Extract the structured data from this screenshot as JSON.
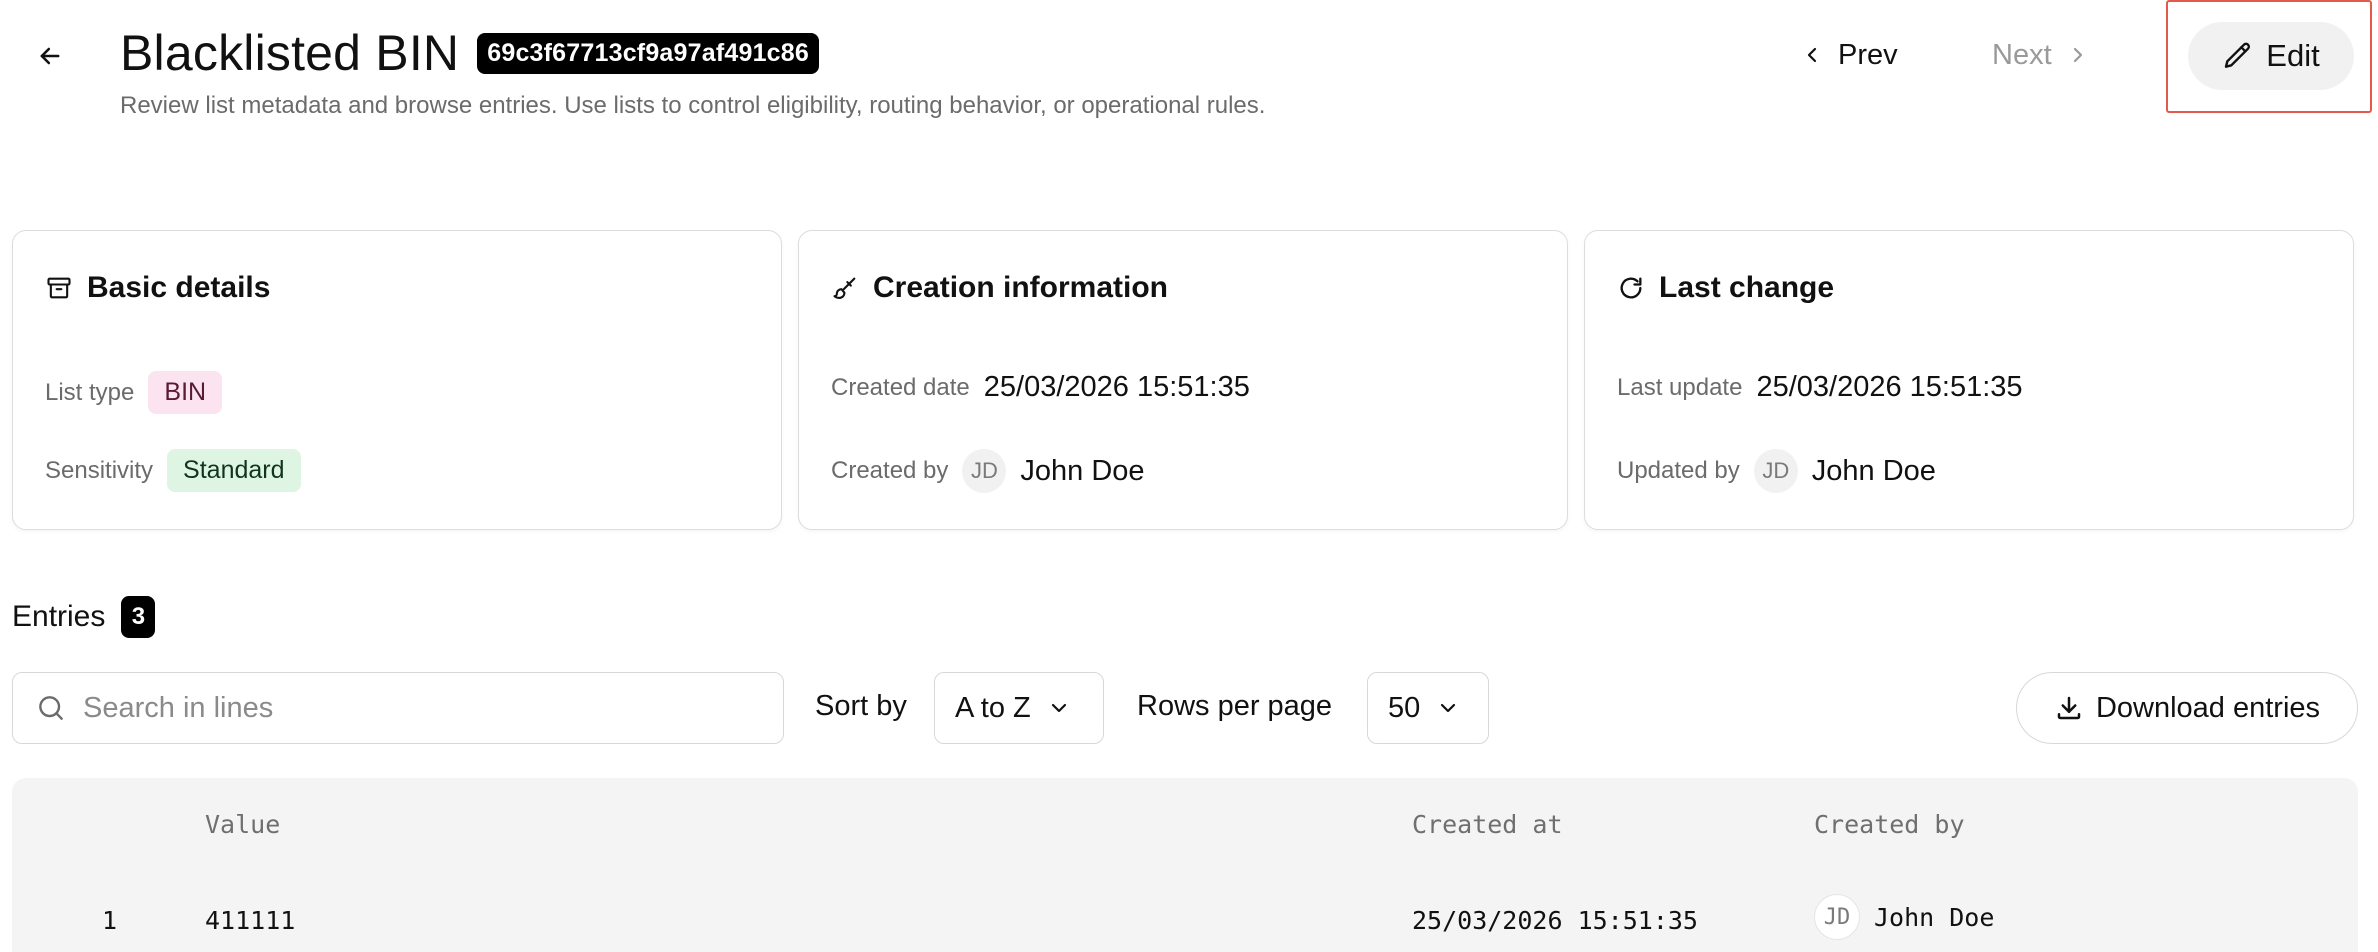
{
  "header": {
    "title": "Blacklisted BIN",
    "id_badge": "69c3f67713cf9a97af491c86",
    "subtitle": "Review list metadata and browse entries. Use lists to control eligibility, routing behavior, or operational rules.",
    "prev_label": "Prev",
    "next_label": "Next",
    "edit_label": "Edit"
  },
  "cards": {
    "basic": {
      "title": "Basic details",
      "list_type_label": "List type",
      "list_type_value": "BIN",
      "sensitivity_label": "Sensitivity",
      "sensitivity_value": "Standard"
    },
    "creation": {
      "title": "Creation information",
      "created_date_label": "Created date",
      "created_date_value": "25/03/2026 15:51:35",
      "created_by_label": "Created by",
      "created_by_initials": "JD",
      "created_by_name": "John Doe"
    },
    "last_change": {
      "title": "Last change",
      "last_update_label": "Last update",
      "last_update_value": "25/03/2026 15:51:35",
      "updated_by_label": "Updated by",
      "updated_by_initials": "JD",
      "updated_by_name": "John Doe"
    }
  },
  "entries": {
    "title": "Entries",
    "count": "3",
    "search_placeholder": "Search in lines",
    "sort_label": "Sort by",
    "sort_value": "A to Z",
    "rows_label": "Rows per page",
    "rows_value": "50",
    "download_label": "Download entries"
  },
  "table": {
    "columns": [
      "Value",
      "Created at",
      "Created by"
    ],
    "rows": [
      {
        "index": "1",
        "value": "411111",
        "created_at": "25/03/2026 15:51:35",
        "initials": "JD",
        "created_by": "John Doe"
      }
    ]
  },
  "colors": {
    "highlight": "#e25a4a",
    "bin_pill": "#fbe4ef",
    "standard_pill": "#dff5e4",
    "table_bg": "#f4f4f4"
  },
  "icons": [
    "arrow-left-icon",
    "chevron-left-icon",
    "chevron-right-icon",
    "pencil-icon",
    "archive-icon",
    "brush-icon",
    "refresh-icon",
    "search-icon",
    "chevron-down-icon",
    "download-icon"
  ]
}
